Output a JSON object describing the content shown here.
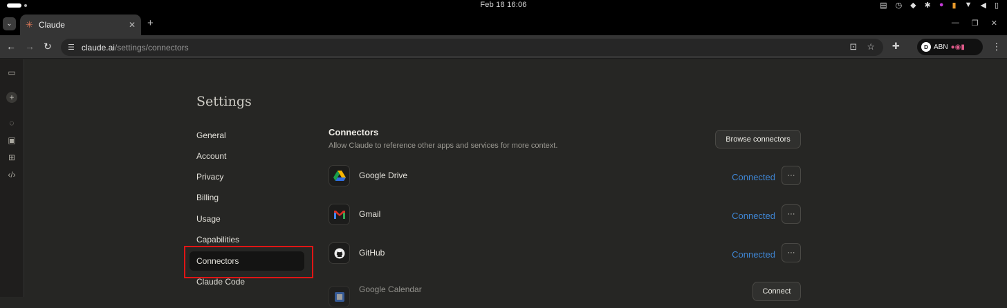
{
  "system": {
    "clock": "Feb 18  16:06",
    "tray_icons": [
      "clipboard-icon",
      "timer-icon",
      "diamond-icon",
      "slack-icon",
      "app-icon",
      "mic-icon",
      "wifi-icon",
      "volume-icon",
      "battery-icon"
    ]
  },
  "browser": {
    "tab_title": "Claude",
    "tab_favicon": "✳",
    "url_host": "claude.ai",
    "url_path": "/settings/connectors",
    "profile_label": "ABN"
  },
  "settings": {
    "title": "Settings",
    "nav": [
      "General",
      "Account",
      "Privacy",
      "Billing",
      "Usage",
      "Capabilities",
      "Connectors",
      "Claude Code"
    ],
    "active_nav": "Connectors"
  },
  "connectors": {
    "title": "Connectors",
    "description": "Allow Claude to reference other apps and services for more context.",
    "browse_label": "Browse connectors",
    "items": [
      {
        "name": "Google Drive",
        "status": "Connected",
        "icon": "google-drive-icon"
      },
      {
        "name": "Gmail",
        "status": "Connected",
        "icon": "gmail-icon"
      },
      {
        "name": "GitHub",
        "status": "Connected",
        "icon": "github-icon"
      },
      {
        "name": "Google Calendar",
        "action": "Connect",
        "icon": "google-calendar-icon"
      }
    ],
    "more_label": "···"
  },
  "colors": {
    "accent_connected": "#3f86d4",
    "highlight": "#e01515",
    "brand": "#d97757"
  }
}
